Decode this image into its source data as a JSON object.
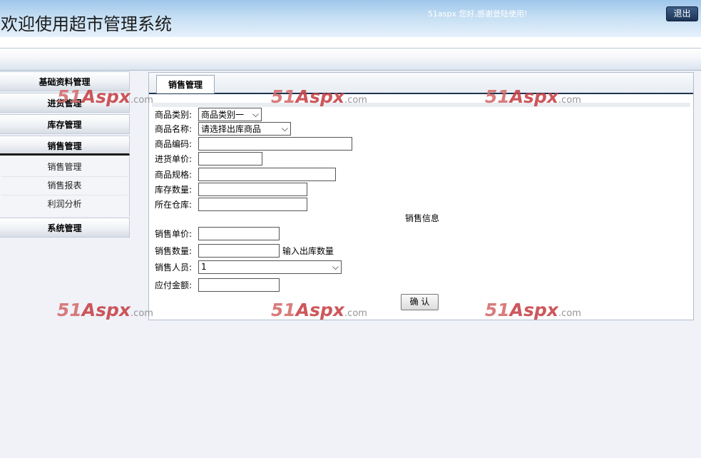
{
  "header": {
    "title": "欢迎使用超市管理系统",
    "welcome": "51aspx 您好,感谢登陆使用!",
    "logout_label": "退出"
  },
  "sidebar": {
    "menus": [
      "基础资料管理",
      "进货管理",
      "库存管理",
      "销售管理",
      "系统管理"
    ],
    "sub_items": [
      "销售管理",
      "销售报表",
      "利润分析"
    ]
  },
  "panel": {
    "tab_label": "销售管理",
    "labels": {
      "category": "商品类别:",
      "name": "商品名称:",
      "code": "商品编码:",
      "purchase_price": "进货单价:",
      "spec": "商品规格:",
      "stock_qty": "库存数量:",
      "warehouse": "所在仓库:",
      "sale_price": "销售单价:",
      "sale_qty": "销售数量:",
      "salesperson": "销售人员:",
      "amount_due": "应付金额:"
    },
    "category_select": "商品类别一",
    "name_select": "请选择出库商品",
    "salesperson_select": "1",
    "section_title": "销售信息",
    "qty_hint": "输入出库数量",
    "confirm_label": "确 认"
  },
  "watermark": {
    "part1": "51",
    "part2": "Aspx",
    "part3": ".com"
  },
  "colors": {
    "accent": "#1e3450",
    "watermark": "#c8454a"
  }
}
